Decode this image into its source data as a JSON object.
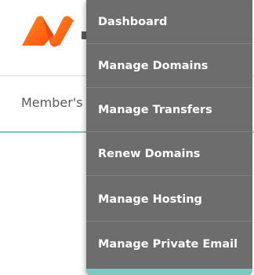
{
  "brand": {
    "logo_icon": "namecheap-n-logo-icon",
    "accent_color": "#ff6a13"
  },
  "nav": {
    "members_label": "Member's"
  },
  "dropdown": {
    "items": [
      {
        "label": "Dashboard"
      },
      {
        "label": "Manage Domains"
      },
      {
        "label": "Manage Transfers"
      },
      {
        "label": "Renew Domains"
      },
      {
        "label": "Manage Hosting"
      },
      {
        "label": "Manage Private Email"
      }
    ]
  },
  "colors": {
    "menu_background": "#6d6d6d",
    "menu_text": "#ffffff",
    "accent_teal": "#7fc8c2"
  }
}
